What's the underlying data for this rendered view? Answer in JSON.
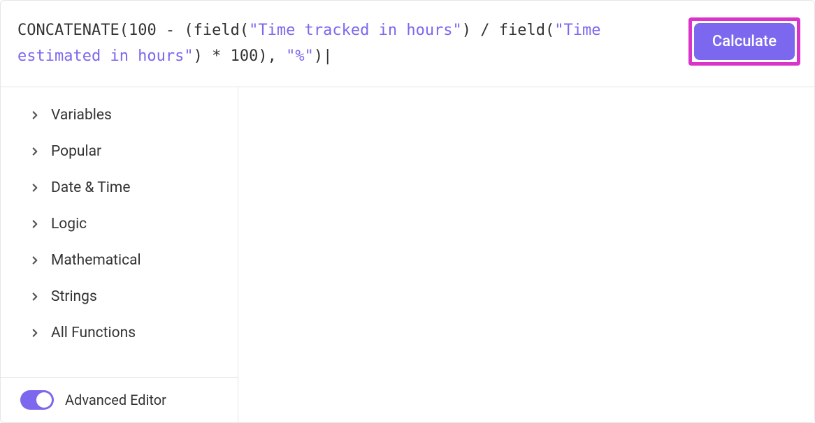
{
  "formula": {
    "tokens": [
      {
        "t": "func",
        "v": "CONCATENATE"
      },
      {
        "t": "plain",
        "v": "(100 - ("
      },
      {
        "t": "field-kw",
        "v": "field"
      },
      {
        "t": "plain",
        "v": "("
      },
      {
        "t": "string",
        "v": "\"Time tracked in hours\""
      },
      {
        "t": "plain",
        "v": ") / "
      },
      {
        "t": "field-kw",
        "v": "field"
      },
      {
        "t": "plain",
        "v": "("
      },
      {
        "t": "string",
        "v": "\"Time estimated in hours\""
      },
      {
        "t": "plain",
        "v": ") * 100), "
      },
      {
        "t": "string",
        "v": "\"%\""
      },
      {
        "t": "plain",
        "v": ")"
      }
    ]
  },
  "calculate_button": "Calculate",
  "categories": [
    "Variables",
    "Popular",
    "Date & Time",
    "Logic",
    "Mathematical",
    "Strings",
    "All Functions"
  ],
  "advanced_editor_label": "Advanced Editor",
  "advanced_editor_on": true
}
